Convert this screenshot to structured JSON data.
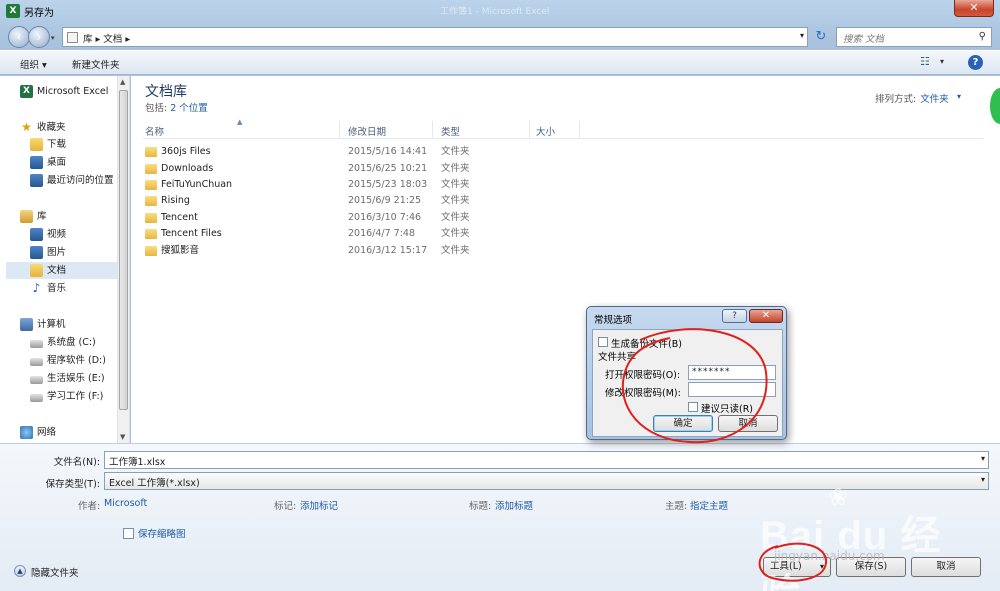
{
  "window": {
    "title": "另存为",
    "ghost_title": "工作簿1 - Microsoft Excel",
    "close_glyph": "✕"
  },
  "nav": {
    "address": "库 ▸ 文档 ▸",
    "search_placeholder": "搜索 文档"
  },
  "toolbar": {
    "organize": "组织 ▾",
    "new_folder": "新建文件夹"
  },
  "sidebar": {
    "items": [
      {
        "label": "Microsoft Excel",
        "icon": "excel-icon"
      },
      {
        "label": "收藏夹",
        "icon": "favorites-star-icon"
      },
      {
        "label": "下载",
        "icon": "downloads-folder-icon"
      },
      {
        "label": "桌面",
        "icon": "desktop-icon"
      },
      {
        "label": "最近访问的位置",
        "icon": "recent-places-icon"
      },
      {
        "label": "库",
        "icon": "libraries-icon"
      },
      {
        "label": "视频",
        "icon": "videos-icon"
      },
      {
        "label": "图片",
        "icon": "pictures-icon"
      },
      {
        "label": "文档",
        "icon": "documents-icon"
      },
      {
        "label": "音乐",
        "icon": "music-icon"
      },
      {
        "label": "计算机",
        "icon": "computer-icon"
      },
      {
        "label": "系统盘 (C:)",
        "icon": "drive-icon"
      },
      {
        "label": "程序软件 (D:)",
        "icon": "drive-icon"
      },
      {
        "label": "生活娱乐 (E:)",
        "icon": "drive-icon"
      },
      {
        "label": "学习工作 (F:)",
        "icon": "drive-icon"
      },
      {
        "label": "网络",
        "icon": "network-icon"
      }
    ]
  },
  "library": {
    "title": "文档库",
    "includes_label": "包括:",
    "includes_link": "2 个位置",
    "arrange_label": "排列方式:",
    "arrange_value": "文件夹"
  },
  "columns": {
    "name": "名称",
    "modified": "修改日期",
    "type": "类型",
    "size": "大小"
  },
  "files": [
    {
      "name": "360js Files",
      "date": "2015/5/16 14:41",
      "type": "文件夹"
    },
    {
      "name": "Downloads",
      "date": "2015/6/25 10:21",
      "type": "文件夹"
    },
    {
      "name": "FeiTuYunChuan",
      "date": "2015/5/23 18:03",
      "type": "文件夹"
    },
    {
      "name": "Rising",
      "date": "2015/6/9 21:25",
      "type": "文件夹"
    },
    {
      "name": "Tencent",
      "date": "2016/3/10 7:46",
      "type": "文件夹"
    },
    {
      "name": "Tencent Files",
      "date": "2016/4/7 7:48",
      "type": "文件夹"
    },
    {
      "name": "搜狐影音",
      "date": "2016/3/12 15:17",
      "type": "文件夹"
    }
  ],
  "save": {
    "filename_label": "文件名(N):",
    "filename_value": "工作簿1.xlsx",
    "filetype_label": "保存类型(T):",
    "filetype_value": "Excel 工作簿(*.xlsx)",
    "author_label": "作者:",
    "author_value": "Microsoft",
    "tags_label": "标记:",
    "tags_value": "添加标记",
    "title_label": "标题:",
    "title_value": "添加标题",
    "subject_label": "主题:",
    "subject_value": "指定主题",
    "thumbnail_label": "保存缩略图",
    "hide_folders": "隐藏文件夹",
    "tools_button": "工具(L)",
    "save_button": "保存(S)",
    "cancel_button": "取消"
  },
  "dialog": {
    "title": "常规选项",
    "help_glyph": "?",
    "close_glyph": "✕",
    "backup_label": "生成备份文件(B)",
    "sharing_label": "文件共享",
    "open_pw_label": "打开权限密码(O):",
    "open_pw_value": "*******",
    "modify_pw_label": "修改权限密码(M):",
    "modify_pw_value": "",
    "readonly_label": "建议只读(R)",
    "ok_button": "确定",
    "cancel_button": "取消"
  },
  "watermark": {
    "text": "Bai du 经验",
    "sub": "jingyan.baidu.com"
  },
  "colors": {
    "accent_link": "#1f5ba8",
    "annotation_red": "#e0201c",
    "frame_blue": "#a9c3df"
  }
}
